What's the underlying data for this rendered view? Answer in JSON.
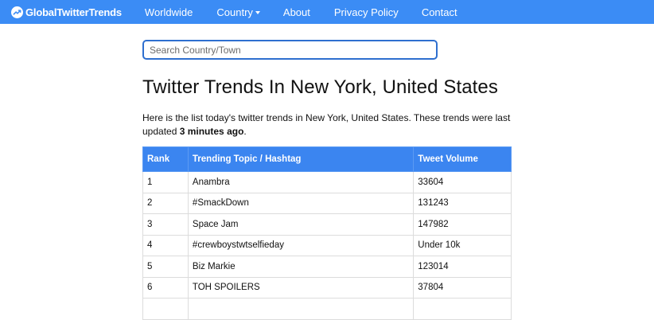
{
  "nav": {
    "brand": "GlobalTwitterTrends",
    "links": [
      {
        "label": "Worldwide"
      },
      {
        "label": "Country"
      },
      {
        "label": "About"
      },
      {
        "label": "Privacy Policy"
      },
      {
        "label": "Contact"
      }
    ]
  },
  "search": {
    "placeholder": "Search Country/Town",
    "value": ""
  },
  "page": {
    "title": "Twitter Trends In New York, United States",
    "intro_text": "Here is the list today's twitter trends in New York, United States. These trends were last updated ",
    "updated_ago": "3 minutes ago",
    "intro_end": "."
  },
  "table": {
    "headers": {
      "rank": "Rank",
      "topic": "Trending Topic / Hashtag",
      "volume": "Tweet Volume"
    },
    "rows": [
      {
        "rank": "1",
        "topic": "Anambra",
        "volume": "33604"
      },
      {
        "rank": "2",
        "topic": "#SmackDown",
        "volume": "131243"
      },
      {
        "rank": "3",
        "topic": "Space Jam",
        "volume": "147982"
      },
      {
        "rank": "4",
        "topic": "#crewboystwtselfieday",
        "volume": "Under 10k"
      },
      {
        "rank": "5",
        "topic": "Biz Markie",
        "volume": "123014"
      },
      {
        "rank": "6",
        "topic": "TOH SPOILERS",
        "volume": "37804"
      },
      {
        "rank": "",
        "topic": "",
        "volume": ""
      }
    ]
  },
  "colors": {
    "navbar": "#3b8cf5",
    "table_header": "#3b85f0",
    "search_border": "#2e6fcf"
  },
  "icons": {
    "brand": "trending-up-icon",
    "country_dropdown": "caret-down-icon"
  }
}
